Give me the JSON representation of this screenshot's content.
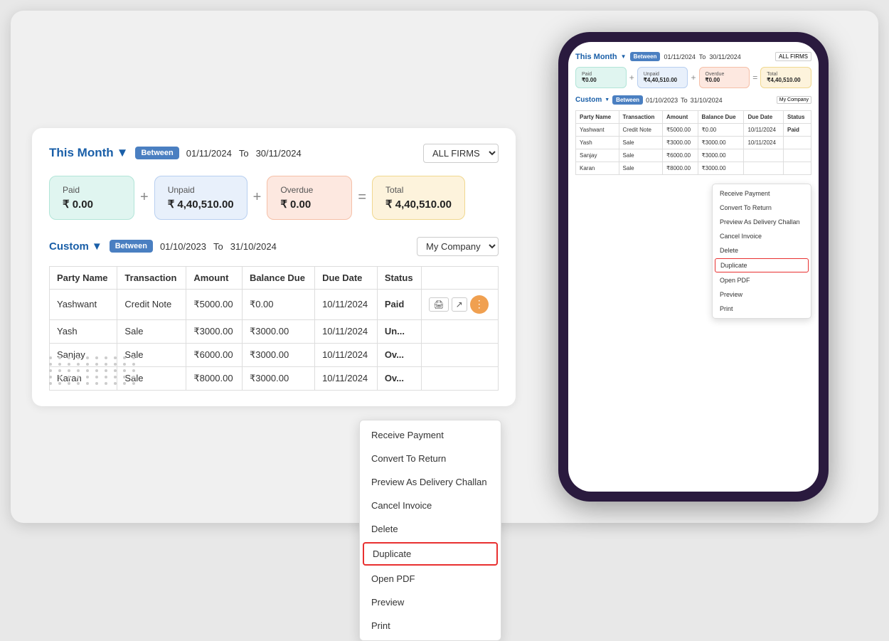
{
  "left": {
    "filter1": {
      "label": "This Month",
      "chevron": "▼",
      "between": "Between",
      "dateFrom": "01/11/2024",
      "dateTo": "30/11/2024",
      "to": "To",
      "firmOptions": [
        "ALL FIRMS"
      ],
      "firmSelected": "ALL FIRMS"
    },
    "summary1": {
      "paid": {
        "label": "Paid",
        "value": "₹ 0.00"
      },
      "unpaid": {
        "label": "Unpaid",
        "value": "₹ 4,40,510.00"
      },
      "overdue": {
        "label": "Overdue",
        "value": "₹ 0.00"
      },
      "total": {
        "label": "Total",
        "value": "₹ 4,40,510.00"
      },
      "plus1": "+",
      "plus2": "+",
      "eq": "="
    },
    "filter2": {
      "label": "Custom",
      "chevron": "▼",
      "between": "Between",
      "dateFrom": "01/10/2023",
      "dateTo": "31/10/2024",
      "to": "To",
      "firmSelected": "My Company"
    },
    "table": {
      "headers": [
        "Party Name",
        "Transaction",
        "Amount",
        "Balance Due",
        "Due Date",
        "Status"
      ],
      "rows": [
        {
          "party": "Yashwant",
          "transaction": "Credit Note",
          "amount": "₹5000.00",
          "balance": "₹0.00",
          "dueDate": "10/11/2024",
          "status": "Paid",
          "statusClass": "paid"
        },
        {
          "party": "Yash",
          "transaction": "Sale",
          "amount": "₹3000.00",
          "balance": "₹3000.00",
          "dueDate": "10/11/2024",
          "status": "Un",
          "statusClass": "un"
        },
        {
          "party": "Sanjay",
          "transaction": "Sale",
          "amount": "₹6000.00",
          "balance": "₹3000.00",
          "dueDate": "10/11/2024",
          "status": "Ov",
          "statusClass": "ov"
        },
        {
          "party": "Karan",
          "transaction": "Sale",
          "amount": "₹8000.00",
          "balance": "₹3000.00",
          "dueDate": "10/11/2024",
          "status": "Ov",
          "statusClass": "ov"
        }
      ]
    },
    "contextMenu": {
      "items": [
        "Receive Payment",
        "Convert To Return",
        "Preview As Delivery Challan",
        "Cancel Invoice",
        "Delete",
        "Duplicate",
        "Open PDF",
        "Preview",
        "Print"
      ],
      "highlighted": "Duplicate"
    }
  },
  "phone": {
    "filter1": {
      "label": "This Month",
      "between": "Between",
      "dateFrom": "01/11/2024",
      "dateTo": "30/11/2024",
      "to": "To",
      "firm": "ALL FIRMS"
    },
    "summary": {
      "paid": {
        "label": "Paid",
        "value": "₹0.00"
      },
      "unpaid": {
        "label": "Unpaid",
        "value": "₹4,40,510.00"
      },
      "overdue": {
        "label": "Overdue",
        "value": "₹0.00"
      },
      "total": {
        "label": "Total",
        "value": "₹4,40,510.00"
      }
    },
    "filter2": {
      "label": "Custom",
      "between": "Between",
      "dateFrom": "01/10/2023",
      "dateTo": "31/10/2024",
      "to": "To",
      "firm": "My Company"
    },
    "table": {
      "headers": [
        "Party Name",
        "Transaction",
        "Amount",
        "Balance Due",
        "Due Date",
        "Status"
      ],
      "rows": [
        {
          "party": "Yashwant",
          "transaction": "Credit Note",
          "amount": "₹5000.00",
          "balance": "₹0.00",
          "dueDate": "10/11/2024",
          "status": "Paid"
        },
        {
          "party": "Yash",
          "transaction": "Sale",
          "amount": "₹3000.00",
          "balance": "₹3000.00",
          "dueDate": "10/11/2024",
          "status": ""
        },
        {
          "party": "Sanjay",
          "transaction": "Sale",
          "amount": "₹6000.00",
          "balance": "₹3000.00",
          "dueDate": "",
          "status": ""
        },
        {
          "party": "Karan",
          "transaction": "Sale",
          "amount": "₹8000.00",
          "balance": "₹3000.00",
          "dueDate": "",
          "status": ""
        }
      ]
    },
    "contextMenu": {
      "items": [
        "Receive Payment",
        "Convert To Return",
        "Preview As Delivery Challan",
        "Cancel Invoice",
        "Delete",
        "Duplicate",
        "Open PDF",
        "Preview",
        "Print"
      ],
      "highlighted": "Duplicate"
    }
  }
}
